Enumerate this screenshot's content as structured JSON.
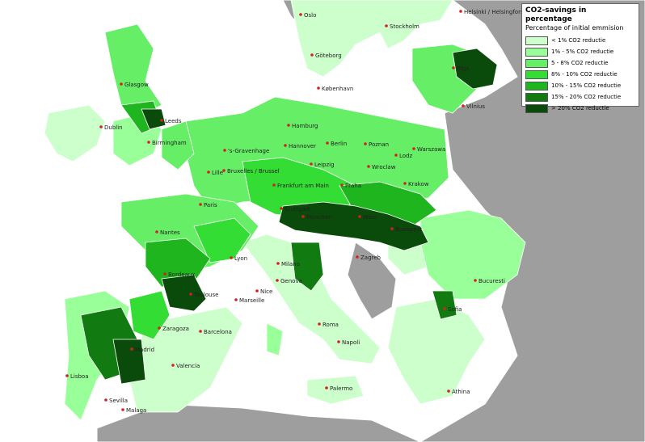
{
  "legend": {
    "title": "CO2-savings in percentage",
    "subtitle": "Percentage of initial emmision",
    "classes": [
      {
        "label": "< 1% CO2 reductie",
        "color": "#ccffcc"
      },
      {
        "label": "1% - 5% CO2 reductie",
        "color": "#99ff99"
      },
      {
        "label": "5 - 8% CO2 reductie",
        "color": "#66ee66"
      },
      {
        "label": "8% - 10%  CO2 reductie",
        "color": "#33dd33"
      },
      {
        "label": "10% - 15%  CO2 reductie",
        "color": "#1fb51f"
      },
      {
        "label": "15% - 20%  CO2 reductie",
        "color": "#117a11"
      },
      {
        "label": "> 20% CO2 reductie",
        "color": "#0a4a0a"
      }
    ]
  },
  "colors": {
    "sea": "#ffffff",
    "non_data_land": "#9e9e9e",
    "city_dot": "#d62020"
  },
  "cities": [
    {
      "name": "Oslo"
    },
    {
      "name": "Helsinki / Helsingfors"
    },
    {
      "name": "Stockholm"
    },
    {
      "name": "Göteborg"
    },
    {
      "name": "Riga"
    },
    {
      "name": "Glasgow"
    },
    {
      "name": "København"
    },
    {
      "name": "Vilnius"
    },
    {
      "name": "Leeds"
    },
    {
      "name": "Dublin"
    },
    {
      "name": "Hamburg"
    },
    {
      "name": "Birmingham"
    },
    {
      "name": "Berlin"
    },
    {
      "name": "Poznan"
    },
    {
      "name": "Warszawa"
    },
    {
      "name": "'s-Gravenhage"
    },
    {
      "name": "Hannover"
    },
    {
      "name": "Lodz"
    },
    {
      "name": "Leipzig"
    },
    {
      "name": "Lille"
    },
    {
      "name": "Bruxelles / Brussel"
    },
    {
      "name": "Wroclaw"
    },
    {
      "name": "Frankfurt am Main"
    },
    {
      "name": "Praha"
    },
    {
      "name": "Krakow"
    },
    {
      "name": "Paris"
    },
    {
      "name": "Stuttgart"
    },
    {
      "name": "München"
    },
    {
      "name": "Wien"
    },
    {
      "name": "Budapest"
    },
    {
      "name": "Nantes"
    },
    {
      "name": "Lyon"
    },
    {
      "name": "Milano"
    },
    {
      "name": "Zagreb"
    },
    {
      "name": "Bordeaux"
    },
    {
      "name": "Genova"
    },
    {
      "name": "Bucuresti"
    },
    {
      "name": "Toulouse"
    },
    {
      "name": "Nice"
    },
    {
      "name": "Marseille"
    },
    {
      "name": "Sofia"
    },
    {
      "name": "Zaragoza"
    },
    {
      "name": "Barcelona"
    },
    {
      "name": "Roma"
    },
    {
      "name": "Madrid"
    },
    {
      "name": "Napoli"
    },
    {
      "name": "Valencia"
    },
    {
      "name": "Lisboa"
    },
    {
      "name": "Palermo"
    },
    {
      "name": "Athina"
    },
    {
      "name": "Sevilla"
    },
    {
      "name": "Malaga"
    }
  ]
}
